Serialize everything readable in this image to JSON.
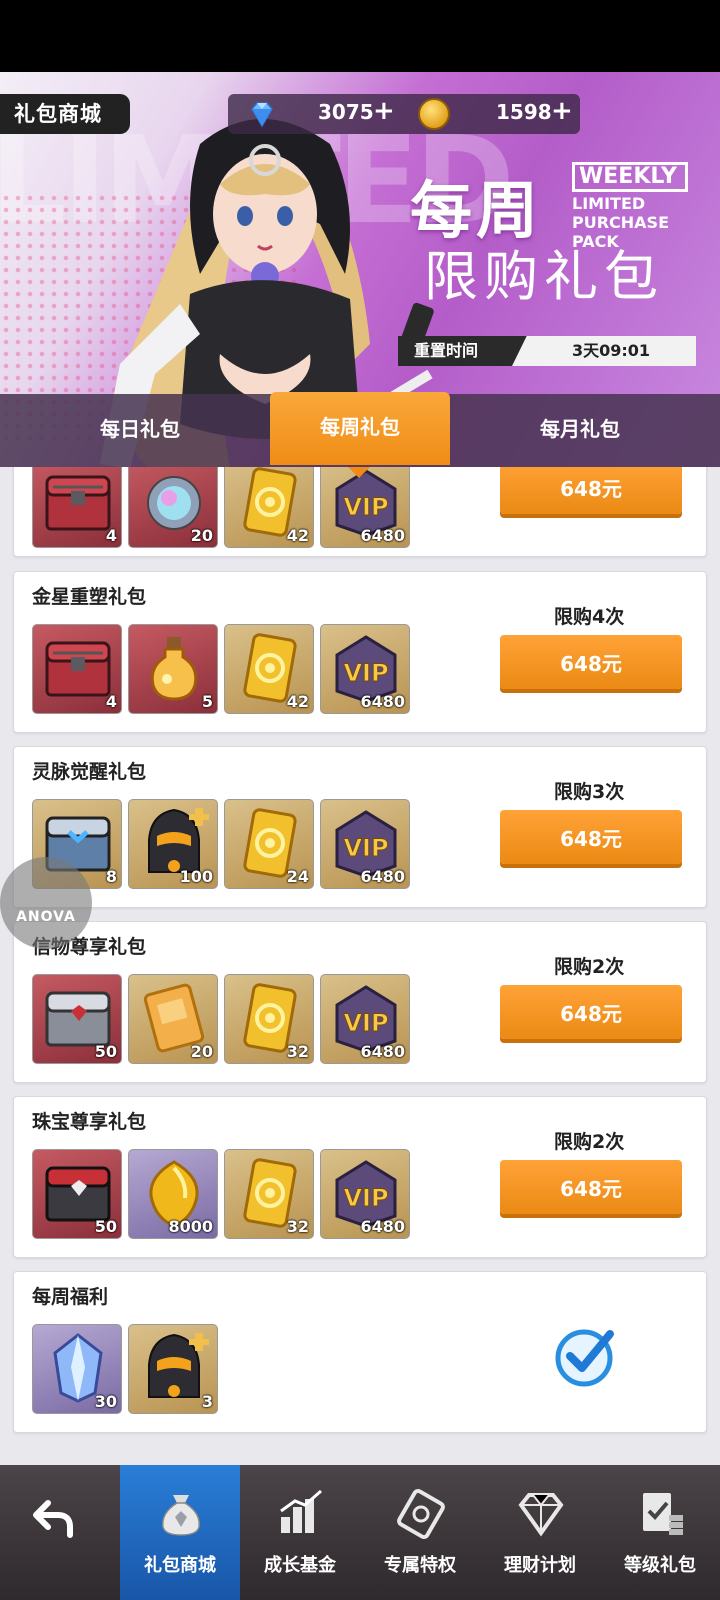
{
  "header": {
    "title": "礼包商城",
    "gems": "3075",
    "coins": "1598",
    "plus": "+"
  },
  "banner": {
    "title_big": "每周",
    "title_sub": "限购礼包",
    "weekly": "WEEKLY",
    "limited_purchase": "LIMITED PURCHASE PACK",
    "reset_label": "重置时间",
    "reset_value": "3天09:01"
  },
  "tabs": [
    {
      "label": "每日礼包"
    },
    {
      "label": "每周礼包"
    },
    {
      "label": "每月礼包"
    }
  ],
  "cards": [
    {
      "title": "",
      "limit": "",
      "price": "648元",
      "items": [
        {
          "icon": "red-chest-icon",
          "qty": "4"
        },
        {
          "icon": "orb-icon",
          "qty": "20"
        },
        {
          "icon": "gold-ticket-icon",
          "qty": "42"
        },
        {
          "icon": "vip-icon",
          "qty": "6480"
        }
      ]
    },
    {
      "title": "金星重塑礼包",
      "limit": "限购4次",
      "price": "648元",
      "items": [
        {
          "icon": "red-chest-icon",
          "qty": "4"
        },
        {
          "icon": "potion-icon",
          "qty": "5"
        },
        {
          "icon": "gold-ticket-icon",
          "qty": "42"
        },
        {
          "icon": "vip-icon",
          "qty": "6480"
        }
      ]
    },
    {
      "title": "灵脉觉醒礼包",
      "limit": "限购3次",
      "price": "648元",
      "items": [
        {
          "icon": "blue-chest-icon",
          "qty": "8"
        },
        {
          "icon": "armor-icon",
          "qty": "100"
        },
        {
          "icon": "gold-ticket-icon",
          "qty": "24"
        },
        {
          "icon": "vip-icon",
          "qty": "6480"
        }
      ]
    },
    {
      "title": "信物尊享礼包",
      "limit": "限购2次",
      "price": "648元",
      "items": [
        {
          "icon": "silver-chest-icon",
          "qty": "50"
        },
        {
          "icon": "coupon-icon",
          "qty": "20"
        },
        {
          "icon": "gold-ticket-icon",
          "qty": "32"
        },
        {
          "icon": "vip-icon",
          "qty": "6480"
        }
      ]
    },
    {
      "title": "珠宝尊享礼包",
      "limit": "限购2次",
      "price": "648元",
      "items": [
        {
          "icon": "black-chest-icon",
          "qty": "50"
        },
        {
          "icon": "gold-gem-icon",
          "qty": "8000"
        },
        {
          "icon": "gold-ticket-icon",
          "qty": "32"
        },
        {
          "icon": "vip-icon",
          "qty": "6480"
        }
      ]
    },
    {
      "title": "每周福利",
      "limit": "",
      "price": "",
      "items": [
        {
          "icon": "crystal-icon",
          "qty": "30"
        },
        {
          "icon": "armor-icon",
          "qty": "3"
        }
      ]
    }
  ],
  "watermark": "ANOVA",
  "nav": [
    {
      "label": "礼包商城"
    },
    {
      "label": "成长基金"
    },
    {
      "label": "专属特权"
    },
    {
      "label": "理财计划"
    },
    {
      "label": "等级礼包"
    }
  ],
  "vip_text": "VIP",
  "colors": {
    "accent": "#f08c16",
    "nav_active": "#1f6cc6",
    "banner": "#c06fd6"
  }
}
